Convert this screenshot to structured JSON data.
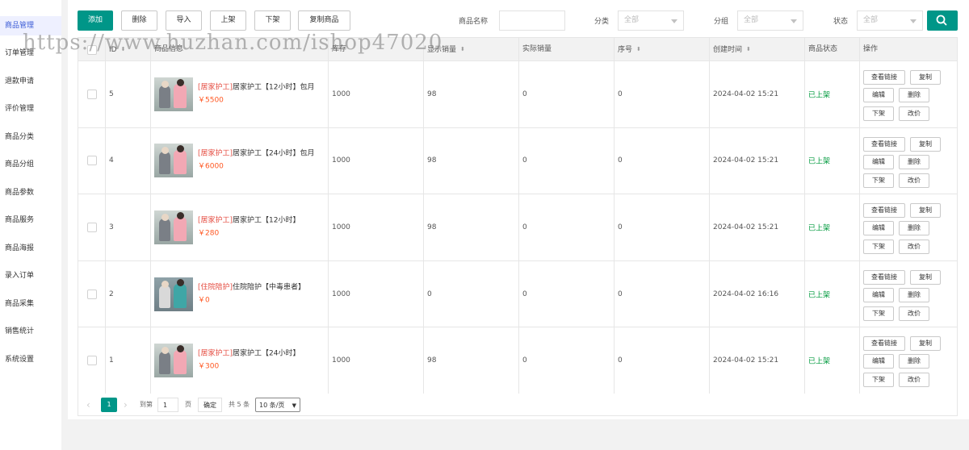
{
  "sidebar": {
    "items": [
      {
        "label": "商品管理",
        "active": true
      },
      {
        "label": "订单管理"
      },
      {
        "label": "退款申请"
      },
      {
        "label": "评价管理"
      },
      {
        "label": "商品分类"
      },
      {
        "label": "商品分组"
      },
      {
        "label": "商品参数"
      },
      {
        "label": "商品服务"
      },
      {
        "label": "商品海报"
      },
      {
        "label": "录入订单"
      },
      {
        "label": "商品采集"
      },
      {
        "label": "销售统计"
      },
      {
        "label": "系统设置"
      }
    ]
  },
  "watermark": "https://www.huzhan.com/ishop47020",
  "toolbar": {
    "add": "添加",
    "delete": "删除",
    "import": "导入",
    "on_shelf": "上架",
    "off_shelf": "下架",
    "copy_goods": "复制商品"
  },
  "filters": {
    "name_label": "商品名称",
    "category_label": "分类",
    "category_value": "全部",
    "group_label": "分组",
    "group_value": "全部",
    "status_label": "状态",
    "status_value": "全部"
  },
  "table": {
    "columns": {
      "id": "ID",
      "goods_info": "商品信息",
      "stock": "库存",
      "display_sales": "显示销量",
      "actual_sales": "实际销量",
      "order": "序号",
      "created": "创建时间",
      "status": "商品状态",
      "actions": "操作"
    },
    "rows": [
      {
        "id": "5",
        "tag": "[居家护工]",
        "title": "居家护工【12小时】包月",
        "price": "￥5500",
        "stock": "1000",
        "display_sales": "98",
        "actual_sales": "0",
        "order": "0",
        "created": "2024-04-02 15:21",
        "status": "已上架"
      },
      {
        "id": "4",
        "tag": "[居家护工]",
        "title": "居家护工【24小时】包月",
        "price": "￥6000",
        "stock": "1000",
        "display_sales": "98",
        "actual_sales": "0",
        "order": "0",
        "created": "2024-04-02 15:21",
        "status": "已上架"
      },
      {
        "id": "3",
        "tag": "[居家护工]",
        "title": "居家护工【12小时】",
        "price": "￥280",
        "stock": "1000",
        "display_sales": "98",
        "actual_sales": "0",
        "order": "0",
        "created": "2024-04-02 15:21",
        "status": "已上架"
      },
      {
        "id": "2",
        "tag": "[住院陪护]",
        "title": "住院陪护【中毒患者】",
        "price": "￥0",
        "stock": "1000",
        "display_sales": "0",
        "actual_sales": "0",
        "order": "0",
        "created": "2024-04-02 16:16",
        "status": "已上架"
      },
      {
        "id": "1",
        "tag": "[居家护工]",
        "title": "居家护工【24小时】",
        "price": "￥300",
        "stock": "1000",
        "display_sales": "98",
        "actual_sales": "0",
        "order": "0",
        "created": "2024-04-02 15:21",
        "status": "已上架"
      }
    ],
    "actions": {
      "view_link": "查看链接",
      "copy": "复制",
      "edit": "编辑",
      "delete": "删除",
      "off_shelf": "下架",
      "change_price": "改价"
    }
  },
  "pager": {
    "prev": "‹",
    "current": "1",
    "next": "›",
    "goto_label": "到第",
    "goto_value": "1",
    "page_label": "页",
    "confirm": "确定",
    "total": "共 5 条",
    "page_size": "10 条/页"
  },
  "colors": {
    "primary": "#009688",
    "status_on": "#009a3e",
    "price": "#ff5722",
    "tag": "#e54d42"
  }
}
